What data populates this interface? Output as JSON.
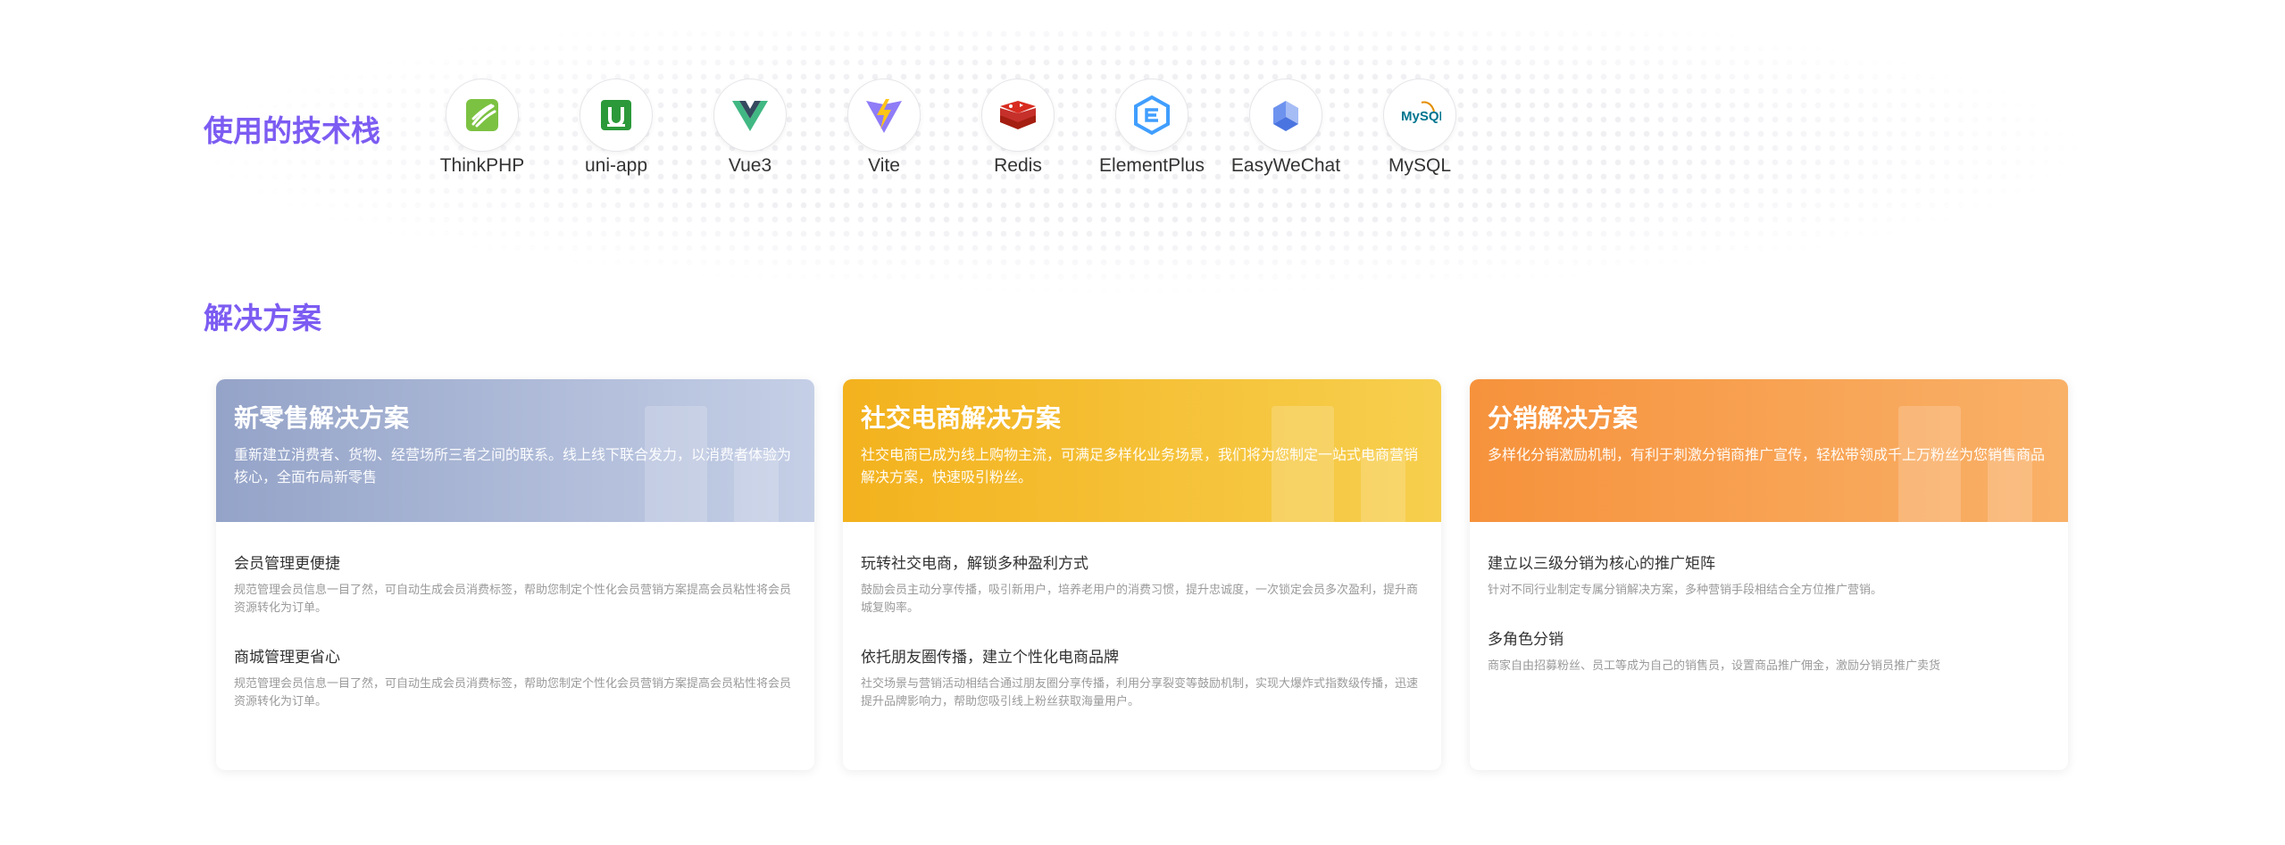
{
  "tech_section": {
    "title": "使用的技术栈",
    "items": [
      {
        "label": "ThinkPHP",
        "icon": "thinkphp-icon"
      },
      {
        "label": "uni-app",
        "icon": "uniapp-icon"
      },
      {
        "label": "Vue3",
        "icon": "vue-icon"
      },
      {
        "label": "Vite",
        "icon": "vite-icon"
      },
      {
        "label": "Redis",
        "icon": "redis-icon"
      },
      {
        "label": "ElementPlus",
        "icon": "elementplus-icon"
      },
      {
        "label": "EasyWeChat",
        "icon": "easywechat-icon"
      },
      {
        "label": "MySQL",
        "icon": "mysql-icon",
        "logo_text": "MySQL"
      }
    ]
  },
  "solution_section": {
    "title": "解决方案",
    "cards": [
      {
        "title": "新零售解决方案",
        "desc": "重新建立消费者、货物、经营场所三者之间的联系。线上线下联合发力，以消费者体验为核心，全面布局新零售",
        "color_from": "#94a3c8",
        "color_to": "#c5cfe6",
        "features": [
          {
            "title": "会员管理更便捷",
            "desc": "规范管理会员信息一目了然，可自动生成会员消费标签，帮助您制定个性化会员营销方案提高会员粘性将会员资源转化为订单。"
          },
          {
            "title": "商城管理更省心",
            "desc": "规范管理会员信息一目了然，可自动生成会员消费标签，帮助您制定个性化会员营销方案提高会员粘性将会员资源转化为订单。"
          }
        ]
      },
      {
        "title": "社交电商解决方案",
        "desc": "社交电商已成为线上购物主流，可满足多样化业务场景，我们将为您制定一站式电商营销解决方案，快速吸引粉丝。",
        "color_from": "#f3b21e",
        "color_to": "#f7cf4e",
        "features": [
          {
            "title": "玩转社交电商，解锁多种盈利方式",
            "desc": "鼓励会员主动分享传播，吸引新用户，培养老用户的消费习惯，提升忠诚度，一次锁定会员多次盈利，提升商城复购率。"
          },
          {
            "title": "依托朋友圈传播，建立个性化电商品牌",
            "desc": "社交场景与营销活动相结合通过朋友圈分享传播，利用分享裂变等鼓励机制，实现大爆炸式指数级传播，迅速提升品牌影响力，帮助您吸引线上粉丝获取海量用户。"
          }
        ]
      },
      {
        "title": "分销解决方案",
        "desc": "多样化分销激励机制，有利于刺激分销商推广宣传，轻松带领成千上万粉丝为您销售商品",
        "color_from": "#f6923c",
        "color_to": "#f9b168",
        "features": [
          {
            "title": "建立以三级分销为核心的推广矩阵",
            "desc": "针对不同行业制定专属分销解决方案，多种营销手段相结合全方位推广营销。"
          },
          {
            "title": "多角色分销",
            "desc": "商家自由招募粉丝、员工等成为自己的销售员，设置商品推广佣金，激励分销员推广卖货"
          }
        ]
      }
    ]
  }
}
